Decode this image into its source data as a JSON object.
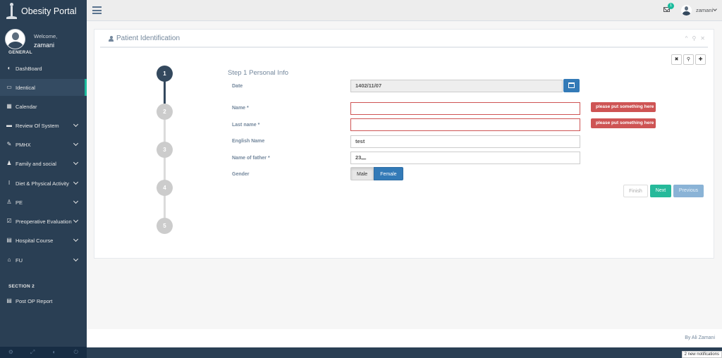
{
  "app": {
    "title": "Obesity Portal"
  },
  "profile": {
    "welcome": "Welcome,",
    "name": "zamani"
  },
  "sidebar": {
    "section_general": "GENERAL",
    "section_two": "SECTION 2",
    "items": [
      {
        "label": "DashBoard",
        "icon": "dashboard-icon",
        "glyph": "◐"
      },
      {
        "label": "Identical",
        "icon": "folder-open-icon",
        "glyph": "▭"
      },
      {
        "label": "Calendar",
        "icon": "calendar-icon",
        "glyph": "▦"
      },
      {
        "label": "Review Of System",
        "icon": "desktop-icon",
        "glyph": "▬"
      },
      {
        "label": "PMHX",
        "icon": "edit-icon",
        "glyph": "✎"
      },
      {
        "label": "Family and social",
        "icon": "users-icon",
        "glyph": "♟"
      },
      {
        "label": "Diet & Physical Activity",
        "icon": "fork-icon",
        "glyph": "ǀ"
      },
      {
        "label": "PE",
        "icon": "male-icon",
        "glyph": "♙"
      },
      {
        "label": "Preoperative Evaluation",
        "icon": "check-square-icon",
        "glyph": "☑"
      },
      {
        "label": "Hospital Course",
        "icon": "clipboard-icon",
        "glyph": "▤"
      },
      {
        "label": "FU",
        "icon": "home-icon",
        "glyph": "⌂"
      },
      {
        "label": "Post OP Report",
        "icon": "file-icon",
        "glyph": "▤"
      }
    ],
    "footer_icons": [
      "gear-icon",
      "fullscreen-icon",
      "eye-slash-icon",
      "power-icon"
    ],
    "footer_glyphs": [
      "⚙",
      "⤢",
      "◐",
      "⏻"
    ]
  },
  "topnav": {
    "mail_count": "1",
    "user": "zamani"
  },
  "panel": {
    "title": "Patient Identification",
    "tools": [
      "^",
      "⚲",
      "✕"
    ],
    "tool_buttons": [
      "✖",
      "⚲",
      "✚"
    ]
  },
  "wizard": {
    "steps": [
      "1",
      "2",
      "3",
      "4",
      "5"
    ],
    "step_title": "Step 1 Personal Info",
    "fields": {
      "date_label": "Date",
      "date_value": "1402/11/07",
      "name_label": "Name *",
      "name_value": "",
      "lastname_label": "Last name *",
      "lastname_value": "",
      "english_label": "English Name",
      "english_value": "test",
      "father_label": "Name of father *",
      "father_value": "23ـــ",
      "gender_label": "Gender"
    },
    "error_tip": "please put something here",
    "gender_options": [
      "Male",
      "Female"
    ],
    "gender_selected": "Female",
    "buttons": {
      "finish": "Finish",
      "next": "Next",
      "previous": "Previous"
    }
  },
  "footer": {
    "credit": "By Ali Zamani"
  },
  "notification": "2 new notifications",
  "colors": {
    "sidebar": "#2a3f54",
    "accent": "#1abb9c",
    "primary": "#337ab7",
    "error": "#ce5454"
  }
}
